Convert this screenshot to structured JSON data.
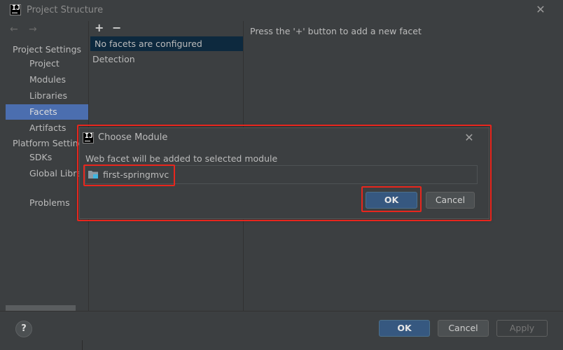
{
  "window": {
    "title": "Project Structure",
    "close_glyph": "✕"
  },
  "nav": {
    "back_glyph": "←",
    "forward_glyph": "→",
    "project_settings_header": "Project Settings",
    "project_items": [
      "Project",
      "Modules",
      "Libraries",
      "Facets",
      "Artifacts"
    ],
    "platform_settings_header": "Platform Settings",
    "platform_items": [
      "SDKs",
      "Global Libraries"
    ],
    "problems": "Problems",
    "selected": "Facets"
  },
  "facets": {
    "add_glyph": "+",
    "remove_glyph": "−",
    "rows": [
      "No facets are configured",
      "Detection"
    ]
  },
  "detail": {
    "hint": "Press the '+' button to add a new facet"
  },
  "footer": {
    "help_glyph": "?",
    "ok_label": "OK",
    "cancel_label": "Cancel",
    "apply_label": "Apply"
  },
  "dialog": {
    "title": "Choose Module",
    "close_glyph": "✕",
    "message": "Web facet will be added to selected module",
    "modules": [
      "first-springmvc"
    ],
    "ok_label": "OK",
    "cancel_label": "Cancel"
  },
  "colors": {
    "background": "#3c3f41",
    "selection": "#4b6eaf",
    "primary_button": "#365880",
    "highlight": "#e8261d"
  },
  "icons": {
    "app": "intellij-icon",
    "folder": "module-folder-icon"
  }
}
